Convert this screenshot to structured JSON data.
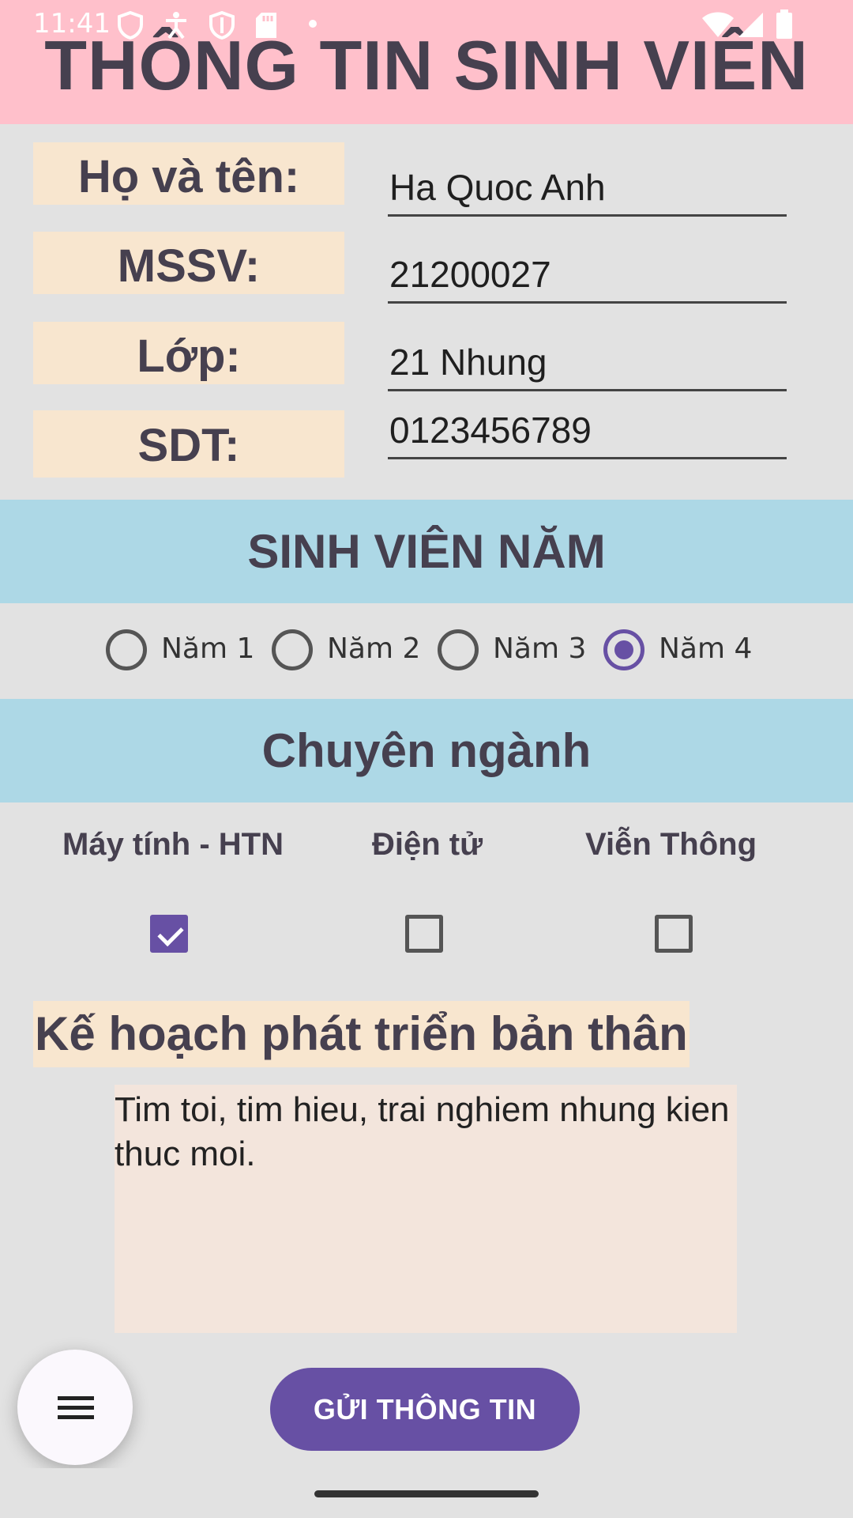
{
  "status_bar": {
    "time": "11:41",
    "icons": [
      "shield-icon",
      "accessibility-icon",
      "shield-icon",
      "sd-card-icon",
      "dot-icon",
      "wifi-icon",
      "signal-icon",
      "battery-icon"
    ]
  },
  "header": {
    "title": "THÔNG TIN SINH VIÊN"
  },
  "form": {
    "name_label": "Họ và tên:",
    "name_value": "Ha Quoc Anh",
    "id_label": "MSSV:",
    "id_value": "21200027",
    "class_label": "Lớp:",
    "class_value": "21 Nhung",
    "phone_label": "SDT:",
    "phone_value": "0123456789"
  },
  "year_section": {
    "title": "SINH VIÊN NĂM",
    "options": [
      {
        "label": "Năm 1",
        "checked": false
      },
      {
        "label": "Năm 2",
        "checked": false
      },
      {
        "label": "Năm 3",
        "checked": false
      },
      {
        "label": "Năm 4",
        "checked": true
      }
    ]
  },
  "major_section": {
    "title": "Chuyên ngành",
    "options": [
      {
        "label": "Máy tính - HTN",
        "checked": true
      },
      {
        "label": "Điện tử",
        "checked": false
      },
      {
        "label": "Viễn Thông",
        "checked": false
      }
    ]
  },
  "plan": {
    "title": "Kế hoạch phát triển bản thân",
    "text": "Tim toi, tim hieu, trai nghiem nhung kien thuc moi."
  },
  "actions": {
    "submit_label": "GỬI THÔNG TIN",
    "menu_icon": "menu-icon"
  },
  "colors": {
    "header_bg": "#ffc0cb",
    "label_bg": "#f8e6cf",
    "band_bg": "#add8e6",
    "accent": "#6750a4",
    "textarea_bg": "#f3e5dc",
    "page_bg": "#e2e2e2"
  }
}
